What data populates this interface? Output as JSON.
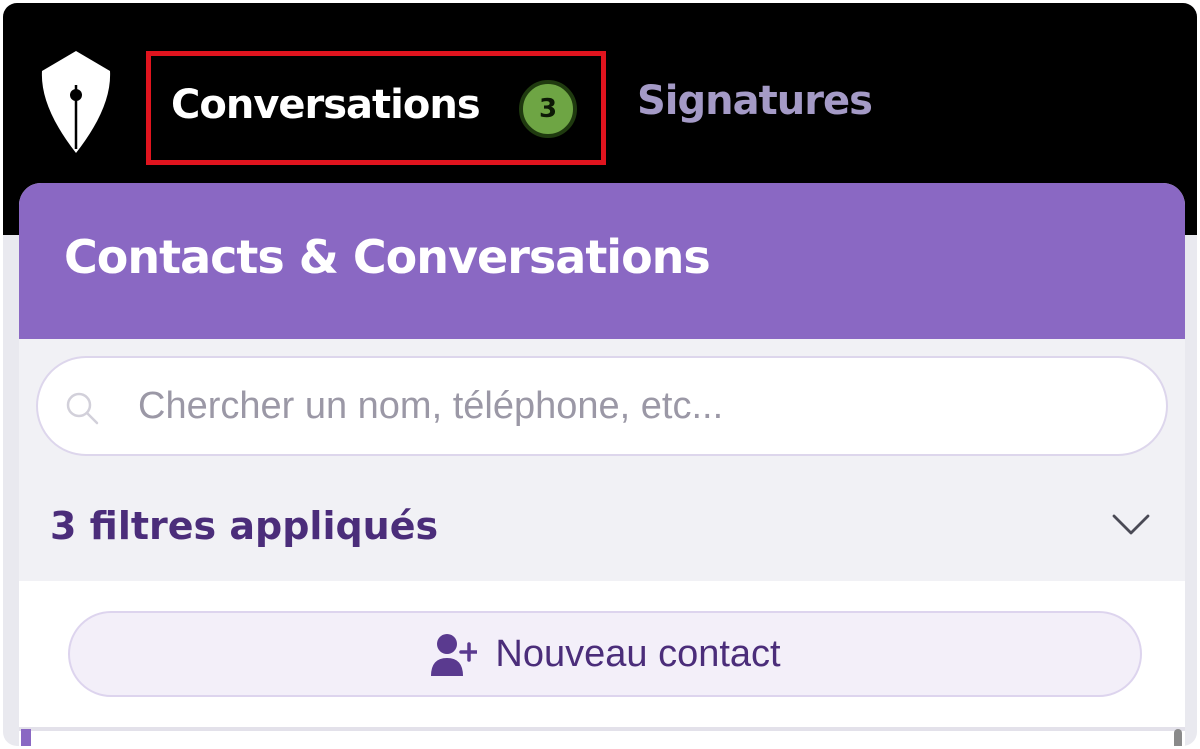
{
  "nav": {
    "logo": "pen-shield-logo",
    "tabs": [
      {
        "label": "Conversations",
        "badge": "3",
        "active": true,
        "highlighted": true
      },
      {
        "label": "Signatures",
        "active": false
      }
    ]
  },
  "panel": {
    "title": "Contacts & Conversations",
    "search": {
      "placeholder": "Chercher un nom, téléphone, etc...",
      "value": ""
    },
    "filters": {
      "label": "3 filtres appliqués"
    },
    "new_contact": {
      "label": "Nouveau contact",
      "icon": "add-user-icon"
    }
  },
  "colors": {
    "topbar": "#000000",
    "header": "#8a68c3",
    "badge": "#6ea544",
    "highlight_box": "#e0141e",
    "inactive_tab": "#a49ac6",
    "accent_text": "#4b2d7a"
  }
}
